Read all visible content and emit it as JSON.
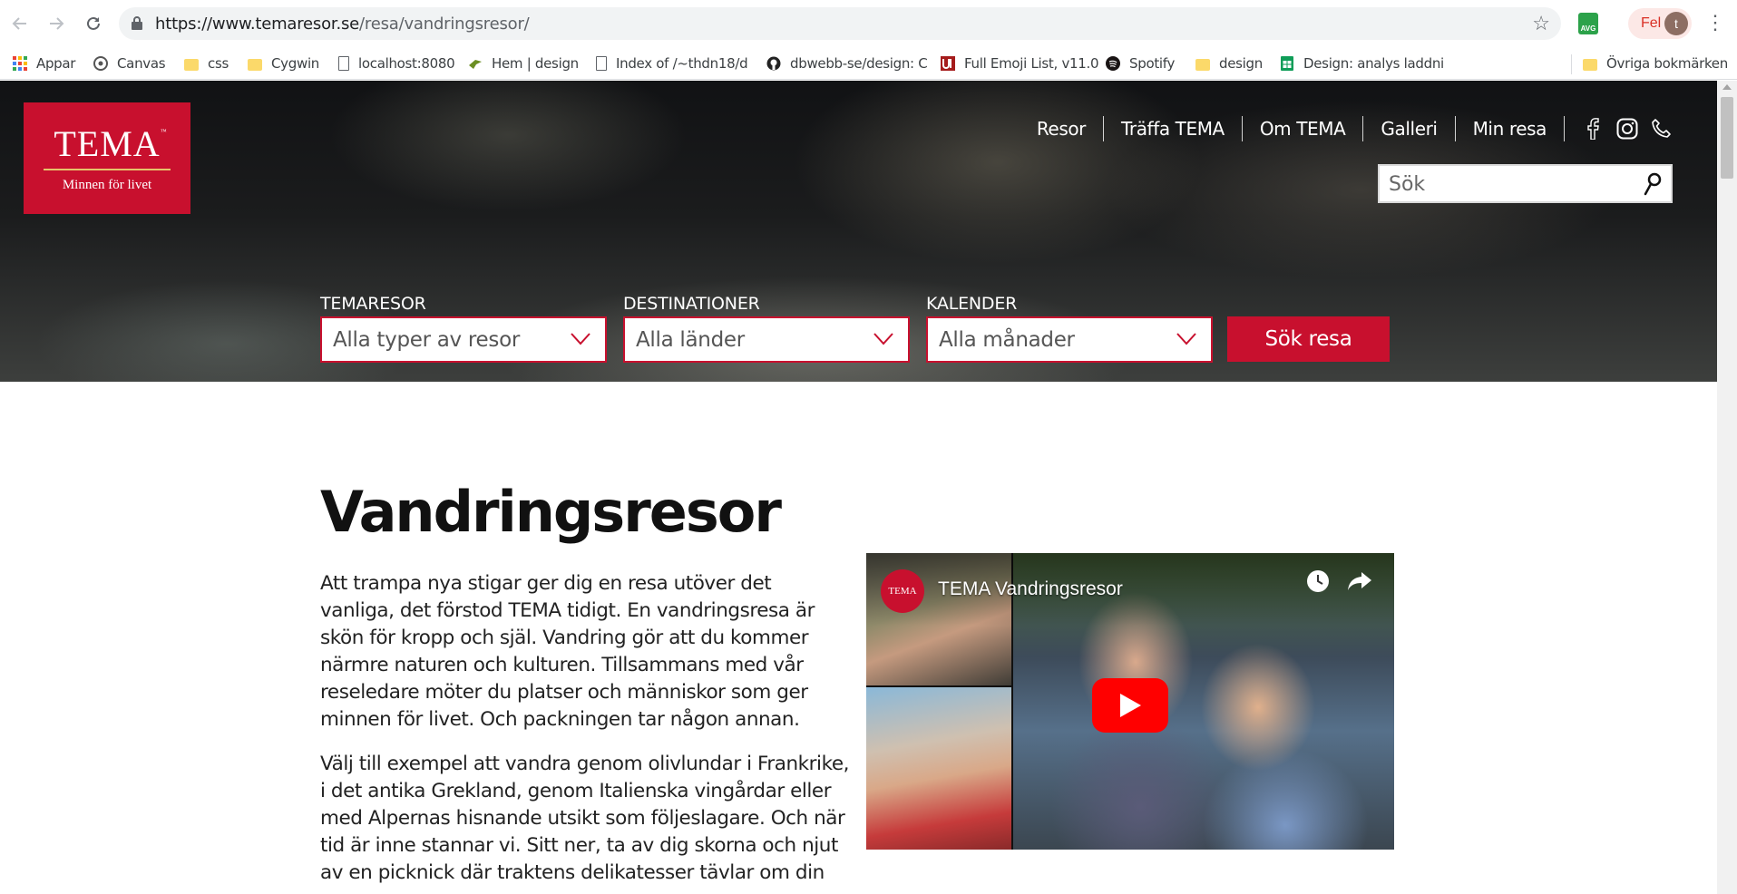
{
  "browser": {
    "url_host": "https://www.temaresor.se",
    "url_path": "/resa/vandringsresor/",
    "profile_status": "Fel",
    "profile_initial": "t",
    "avg_label": "AVG",
    "bookmarks": [
      {
        "label": "Appar",
        "icon": "apps-grid-icon"
      },
      {
        "label": "Canvas",
        "icon": "canvas-icon"
      },
      {
        "label": "css",
        "icon": "folder-icon"
      },
      {
        "label": "Cygwin",
        "icon": "folder-icon"
      },
      {
        "label": "localhost:8080",
        "icon": "page-icon"
      },
      {
        "label": "Hem | design",
        "icon": "bird-icon"
      },
      {
        "label": "Index of /~thdn18/d",
        "icon": "page-icon"
      },
      {
        "label": "dbwebb-se/design: C",
        "icon": "github-icon"
      },
      {
        "label": "Full Emoji List, v11.0",
        "icon": "unicode-icon"
      },
      {
        "label": "Spotify",
        "icon": "spotify-icon"
      },
      {
        "label": "design",
        "icon": "folder-icon"
      },
      {
        "label": "Design: analys laddni",
        "icon": "sheets-icon"
      },
      {
        "label": "Övriga bokmärken",
        "icon": "folder-icon"
      }
    ]
  },
  "site": {
    "brand": "TEMA",
    "brand_tm": "™",
    "tagline": "Minnen för livet",
    "accent_color": "#c8102e",
    "nav": [
      "Resor",
      "Träffa TEMA",
      "Om TEMA",
      "Galleri",
      "Min resa"
    ],
    "social_icons": [
      "facebook-icon",
      "instagram-icon",
      "phone-icon"
    ],
    "search_placeholder": "Sök"
  },
  "filters": {
    "themes": {
      "label": "TEMARESOR",
      "value": "Alla typer av resor"
    },
    "destinations": {
      "label": "DESTINATIONER",
      "value": "Alla länder"
    },
    "calendar": {
      "label": "KALENDER",
      "value": "Alla månader"
    },
    "submit_label": "Sök resa"
  },
  "content": {
    "title": "Vandringsresor",
    "paragraph_1": "Att trampa nya stigar ger dig en resa utöver det vanliga, det förstod TEMA tidigt. En vandringsresa är skön för kropp och själ. Vandring gör att du kommer närmre naturen och kulturen. Tillsammans med vår reseledare möter du platser och människor som ger minnen för livet. Och packningen tar någon annan.",
    "paragraph_2": "Välj till exempel att vandra genom olivlundar i Frankrike, i det antika Grekland, genom Italienska vingårdar eller med Alpernas hisnande utsikt som följeslagare. Och när tid är inne stannar vi. Sitt ner, ta av dig skorna och njut av en picknick där traktens delikatesser tävlar om din"
  },
  "video": {
    "title": "TEMA Vandringsresor",
    "channel_logo": "TEMA"
  }
}
